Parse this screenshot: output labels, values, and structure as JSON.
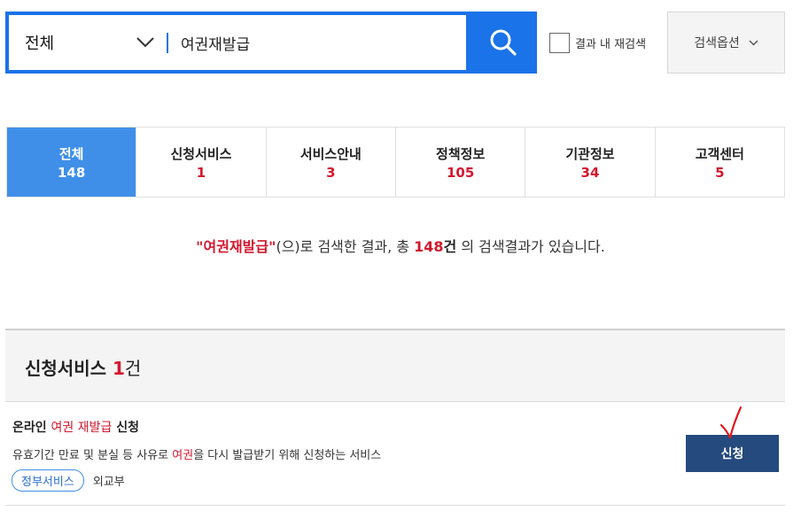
{
  "search": {
    "scope_label": "전체",
    "query": "여권재발급",
    "recheck_label": "결과 내 재검색",
    "options_label": "검색옵션"
  },
  "tabs": [
    {
      "label": "전체",
      "count": "148",
      "active": true
    },
    {
      "label": "신청서비스",
      "count": "1",
      "active": false
    },
    {
      "label": "서비스안내",
      "count": "3",
      "active": false
    },
    {
      "label": "정책정보",
      "count": "105",
      "active": false
    },
    {
      "label": "기관정보",
      "count": "34",
      "active": false
    },
    {
      "label": "고객센터",
      "count": "5",
      "active": false
    }
  ],
  "summary": {
    "open_quote": "\"",
    "keyword": "여권재발급",
    "close_quote": "\"",
    "text_1": "(으)로 검색한 결과, 총 ",
    "total": "148",
    "unit": "건",
    "text_2": " 의 검색결과가 있습니다."
  },
  "section": {
    "title": "신청서비스",
    "count": "1",
    "unit": "건"
  },
  "result": {
    "title_pre": "온라인 ",
    "title_hl": "여권 재발급",
    "title_post": " 신청",
    "desc_pre": "유효기간 만료 및 분실 등 사유로 ",
    "desc_hl": "여권",
    "desc_post": "을 다시 발급받기 위해 신청하는 서비스",
    "tag": "정부서비스",
    "org": "외교부",
    "button_label": "신청"
  },
  "colors": {
    "primary_blue": "#1a73e8",
    "active_tab": "#3f8fe8",
    "highlight_red": "#d3172e",
    "apply_button": "#244a7e"
  }
}
